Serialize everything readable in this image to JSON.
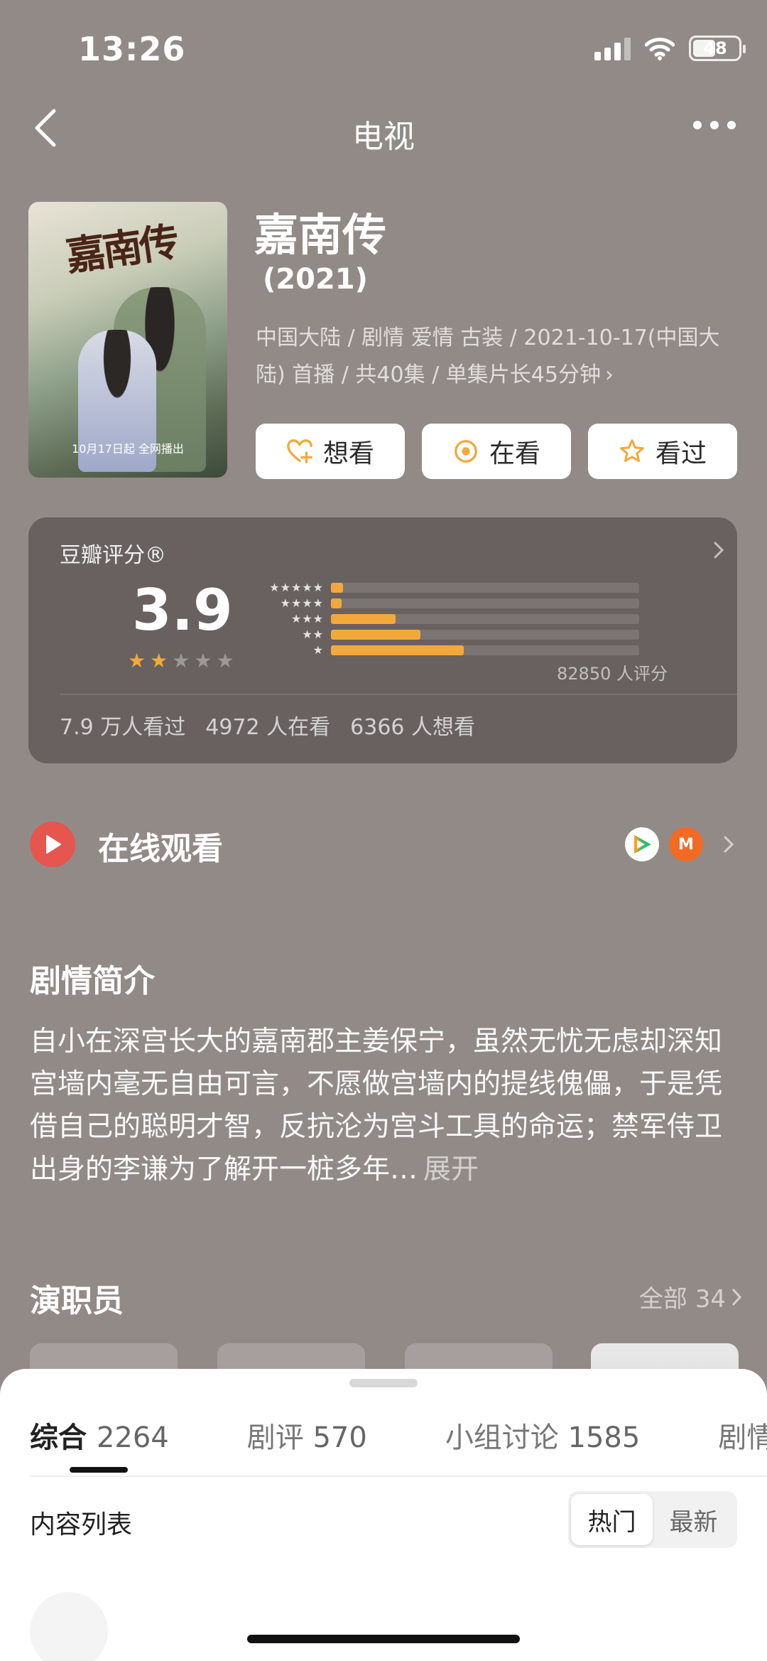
{
  "status_bar": {
    "time": "13:26",
    "battery": "48"
  },
  "nav": {
    "title": "电视"
  },
  "poster": {
    "title_text": "嘉南传",
    "date_text": "10月17日起 全网播出"
  },
  "show": {
    "title": "嘉南传",
    "year": "(2021)",
    "meta_line1": "中国大陆 / 剧情 爱情 古装 / 2021-10-17(中国大",
    "meta_line2": "陆) 首播 / 共40集 / 单集片长45分钟"
  },
  "actions": [
    {
      "label": "想看",
      "icon": "heart-plus-icon"
    },
    {
      "label": "在看",
      "icon": "target-circle-icon"
    },
    {
      "label": "看过",
      "icon": "star-outline-icon"
    }
  ],
  "rating": {
    "label": "豆瓣评分®",
    "score": "3.9",
    "star_value": 2,
    "distribution": [
      {
        "stars": "★★★★★",
        "fraction": 0.04
      },
      {
        "stars": "★★★★",
        "fraction": 0.035
      },
      {
        "stars": "★★★",
        "fraction": 0.21
      },
      {
        "stars": "★★",
        "fraction": 0.29
      },
      {
        "stars": "★",
        "fraction": 0.43
      }
    ],
    "count_text": "82850 人评分",
    "stats": [
      "7.9 万人看过",
      "4972 人在看",
      "6366 人想看"
    ],
    "colors": {
      "bar": "#f2a93b",
      "star": "#f2a93b"
    }
  },
  "online": {
    "label": "在线观看",
    "providers": [
      "tencent-video-icon",
      "mango-tv-icon"
    ]
  },
  "synopsis": {
    "title": "剧情简介",
    "text": "自小在深宫长大的嘉南郡主姜保宁，虽然无忧无虑却深知宫墙内毫无自由可言，不愿做宫墙内的提线傀儡，于是凭借自己的聪明才智，反抗沦为宫斗工具的命运；禁军侍卫出身的李谦为了解开一桩多年…",
    "expand": "展开"
  },
  "cast": {
    "title": "演职员",
    "all_label": "全部 34"
  },
  "sheet": {
    "tabs": [
      {
        "label": "综合",
        "count": "2264"
      },
      {
        "label": "剧评",
        "count": "570"
      },
      {
        "label": "小组讨论",
        "count": "1585"
      },
      {
        "label": "剧情",
        "count": ""
      }
    ],
    "list_label": "内容列表",
    "sort_options": [
      "热门",
      "最新"
    ],
    "sort_selected": "热门"
  }
}
